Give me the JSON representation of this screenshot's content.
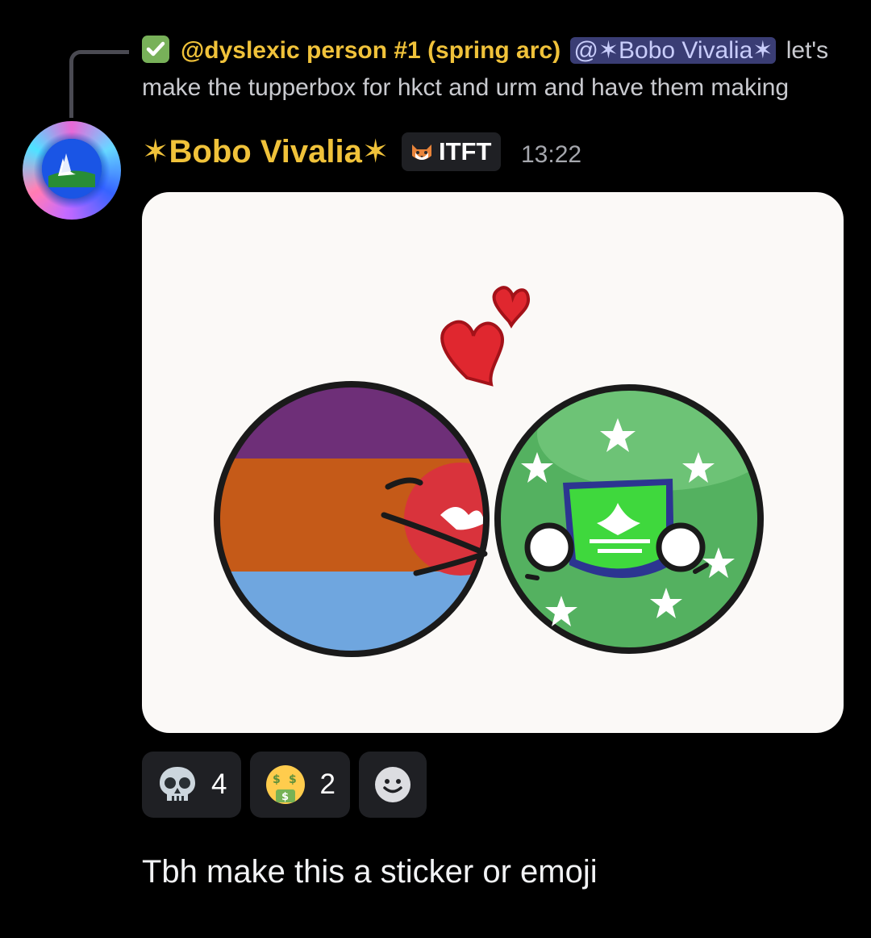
{
  "reply": {
    "check_icon": "white-check-mark-emoji",
    "author": "@dyslexic person #1 (spring arc)",
    "mention": "@✶Bobo Vivalia✶",
    "text": "let's make the tupperbox for hkct and urm and have them making"
  },
  "message": {
    "author": "✶Bobo Vivalia✶",
    "tag_icon": "cat-face-icon",
    "tag": "ITFT",
    "timestamp": "13:22",
    "image_alt": "countryball drawing with hearts"
  },
  "reactions": [
    {
      "emoji": "skull-emoji",
      "count": "4"
    },
    {
      "emoji": "money-mouth-face-emoji",
      "count": "2"
    },
    {
      "emoji": "add-reaction-icon",
      "count": ""
    }
  ],
  "message2": {
    "text": "Tbh make this a sticker or emoji"
  },
  "colors": {
    "background": "#000000",
    "author_gold": "#f0c23a",
    "mention_bg": "#3a3d74",
    "reaction_bg": "#1f2024",
    "timestamp": "#a5a7ad"
  }
}
